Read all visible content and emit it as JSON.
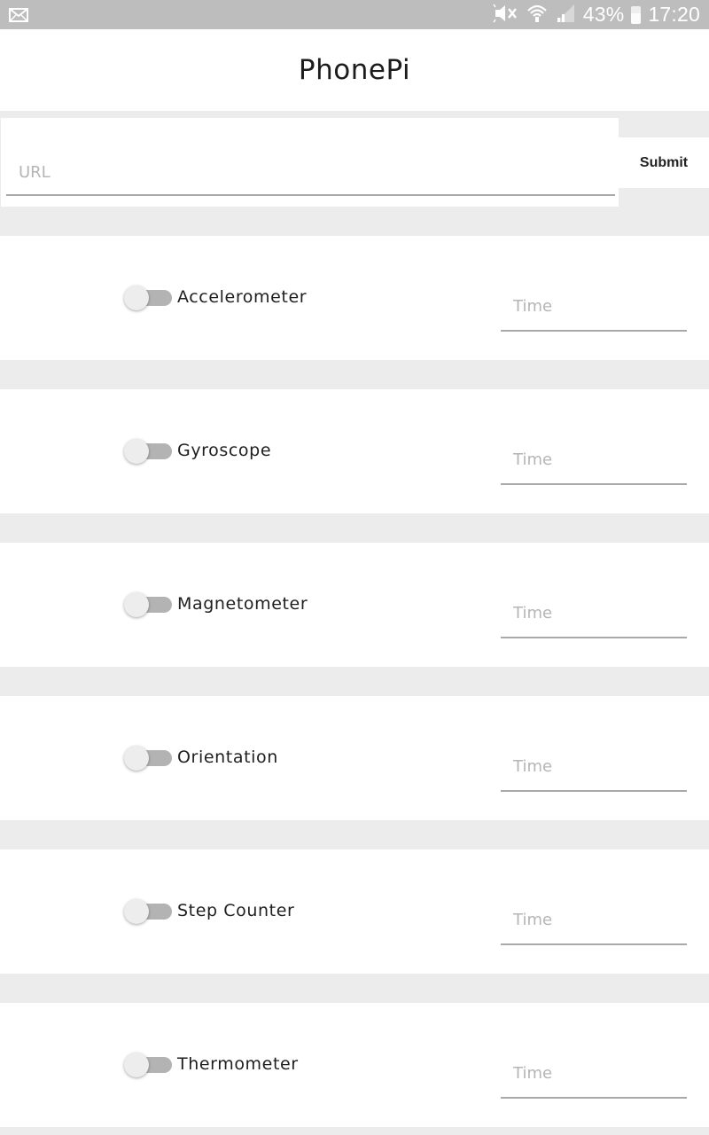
{
  "status_bar": {
    "notification_icon": "mail-icon",
    "icons": [
      "mute-icon",
      "wifi-icon",
      "signal-icon"
    ],
    "battery": "43%",
    "time": "17:20"
  },
  "app": {
    "title": "PhonePi"
  },
  "url_form": {
    "placeholder": "URL",
    "value": "",
    "submit_label": "Submit"
  },
  "sensors": [
    {
      "label": "Accelerometer",
      "enabled": false,
      "time_placeholder": "Time"
    },
    {
      "label": "Gyroscope",
      "enabled": false,
      "time_placeholder": "Time"
    },
    {
      "label": "Magnetometer",
      "enabled": false,
      "time_placeholder": "Time"
    },
    {
      "label": "Orientation",
      "enabled": false,
      "time_placeholder": "Time"
    },
    {
      "label": "Step Counter",
      "enabled": false,
      "time_placeholder": "Time"
    },
    {
      "label": "Thermometer",
      "enabled": false,
      "time_placeholder": "Time"
    }
  ],
  "colors": {
    "status_bar": "#bdbdbd",
    "background": "#ececec",
    "toggle_track_off": "#b3b3b3",
    "toggle_thumb_off": "#ededed",
    "underline": "#a9a9a9"
  }
}
